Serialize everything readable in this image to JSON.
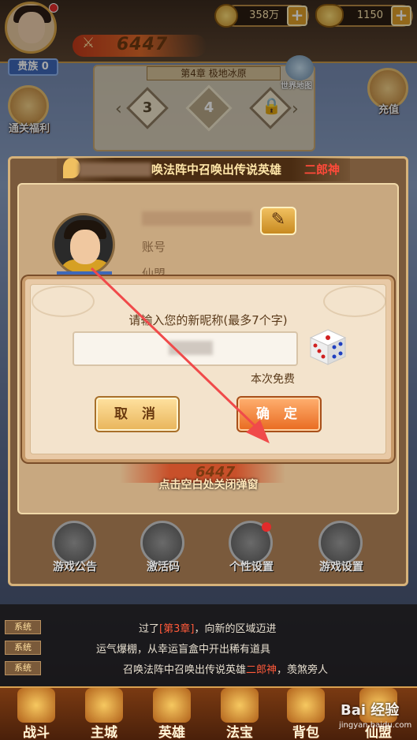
{
  "top": {
    "noble_label": "贵族",
    "noble_level": "0",
    "power": "6447",
    "copper": "358万",
    "gold": "1150",
    "plus": "+"
  },
  "chapter": {
    "title": "第4章 极地冰原",
    "nodes": [
      "3",
      "4"
    ],
    "world_map": "世界地图"
  },
  "side": {
    "left_label": "通关福利",
    "right_label": "充值"
  },
  "panel": {
    "banner_text": "唤法阵中召唤出传说英雄",
    "banner_hero": "二郎神",
    "account_label": "账号",
    "guild_label": "仙盟"
  },
  "popup": {
    "prompt": "请输入您的新昵称(最多7个字)",
    "free_text": "本次免费",
    "cancel": "取 消",
    "ok": "确 定"
  },
  "below": {
    "power": "6447",
    "close_hint": "点击空白处关闭弹窗",
    "options": [
      "游戏公告",
      "激活码",
      "个性设置",
      "游戏设置"
    ]
  },
  "chat": {
    "tag": "系统",
    "lines": [
      {
        "pre": "过了",
        "hl": "[第3章]",
        "post": "，向新的区域迈进"
      },
      {
        "pre": "运气爆棚，从幸运盲盒中开出稀有道具",
        "hl": "",
        "post": ""
      },
      {
        "pre": "召唤法阵中召唤出传说英雄",
        "hl": "二郎神",
        "post": "，羡煞旁人"
      }
    ]
  },
  "nav": {
    "items": [
      "战斗",
      "主城",
      "英雄",
      "法宝",
      "背包",
      "仙盟"
    ]
  },
  "watermark": {
    "main": "Bai 经验",
    "sub": "jingyan.baidu.com"
  },
  "colors": {
    "ok_button": "#e86a20",
    "cancel_button": "#e8b45a",
    "arrow": "#f04a4a",
    "highlight": "#ff5a3a"
  }
}
